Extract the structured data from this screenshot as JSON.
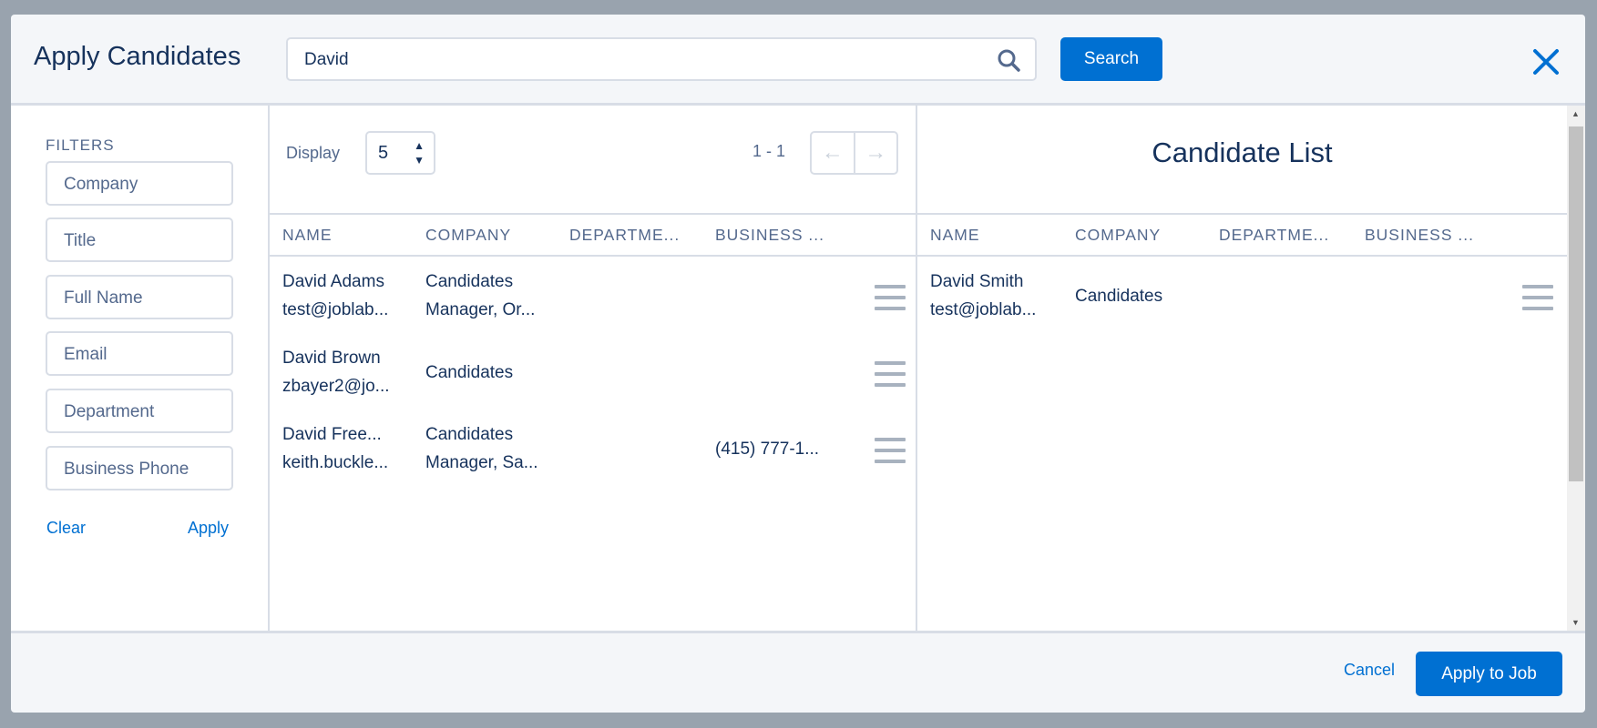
{
  "header": {
    "title": "Apply Candidates",
    "search_value": "David",
    "search_button": "Search"
  },
  "filters": {
    "label": "FILTERS",
    "fields": [
      "Company",
      "Title",
      "Full Name",
      "Email",
      "Department",
      "Business Phone"
    ],
    "clear": "Clear",
    "apply": "Apply"
  },
  "results": {
    "display_label": "Display",
    "display_value": "5",
    "range": "1 - 1",
    "columns": [
      "NAME",
      "COMPANY",
      "DEPARTME...",
      "BUSINESS ..."
    ],
    "rows": [
      {
        "name": "David Adams",
        "email": "test@joblab...",
        "company1": "Candidates",
        "company2": "Manager, Or...",
        "department": "",
        "phone": ""
      },
      {
        "name": "David Brown",
        "email": "zbayer2@jo...",
        "company1": "Candidates",
        "company2": "",
        "department": "",
        "phone": ""
      },
      {
        "name": "David Free...",
        "email": "keith.buckle...",
        "company1": "Candidates",
        "company2": "Manager, Sa...",
        "department": "",
        "phone": "(415) 777-1..."
      }
    ]
  },
  "candidate_list": {
    "title": "Candidate List",
    "columns": [
      "NAME",
      "COMPANY",
      "DEPARTME...",
      "BUSINESS ..."
    ],
    "rows": [
      {
        "name": "David Smith",
        "email": "test@joblab...",
        "company": "Candidates",
        "department": "",
        "phone": ""
      }
    ]
  },
  "footer": {
    "cancel": "Cancel",
    "apply_to_job": "Apply to Job"
  },
  "colors": {
    "accent": "#0070d2",
    "text": "#16325c",
    "muted": "#54698d",
    "border": "#d8dde6"
  }
}
